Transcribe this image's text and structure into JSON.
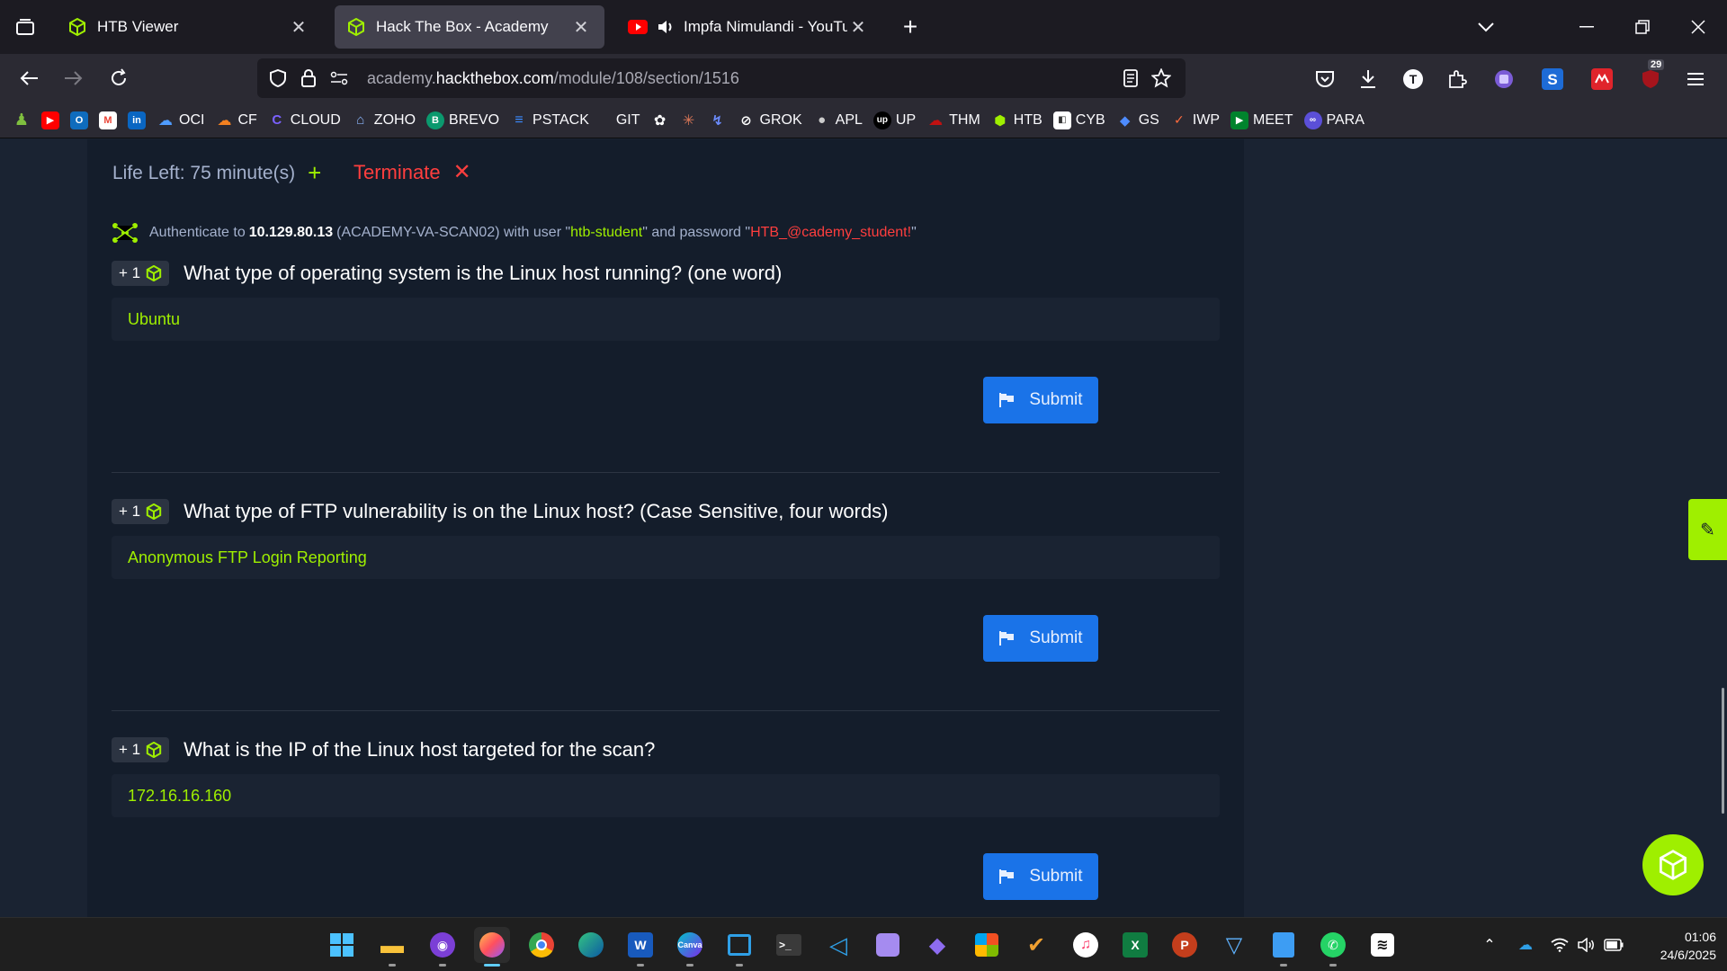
{
  "browser": {
    "tabs": [
      {
        "title": "HTB Viewer",
        "active": false
      },
      {
        "title": "Hack The Box - Academy",
        "active": true
      },
      {
        "title": "Impfa Nimulandi - YouTube",
        "active": false
      }
    ],
    "url": {
      "prefix": "academy.",
      "host": "hackthebox.com",
      "path": "/module/108/section/1516"
    },
    "extension_badge": "29",
    "bookmarks": [
      "OCI",
      "CF",
      "CLOUD",
      "ZOHO",
      "BREVO",
      "PSTACK",
      "GIT",
      "GROK",
      "APL",
      "UP",
      "THM",
      "HTB",
      "CYB",
      "GS",
      "IWP",
      "MEET",
      "PARA"
    ]
  },
  "page": {
    "life_left": "Life Left: 75 minute(s)",
    "terminate": "Terminate",
    "auth": {
      "prefix": "Authenticate to",
      "ip": "10.129.80.13",
      "host": "(ACADEMY-VA-SCAN02) with user \"",
      "user": "htb-student",
      "mid": "\" and password \"",
      "password": "HTB_@cademy_student!",
      "suffix": "\""
    },
    "questions": [
      {
        "points": "+ 1",
        "text": "What type of operating system is the Linux host running? (one word)",
        "answer": "Ubuntu",
        "submit": "Submit"
      },
      {
        "points": "+ 1",
        "text": "What type of FTP vulnerability is on the Linux host? (Case Sensitive, four words)",
        "answer": "Anonymous FTP Login Reporting",
        "submit": "Submit"
      },
      {
        "points": "+ 1",
        "text": "What is the IP of the Linux host targeted for the scan?",
        "answer": "172.16.16.160",
        "submit": "Submit"
      }
    ],
    "colors": {
      "accent": "#9fef00",
      "danger": "#ff3e3e",
      "button": "#1a73e8"
    }
  },
  "taskbar": {
    "clock_time": "01:06",
    "clock_date": "24/6/2025"
  }
}
